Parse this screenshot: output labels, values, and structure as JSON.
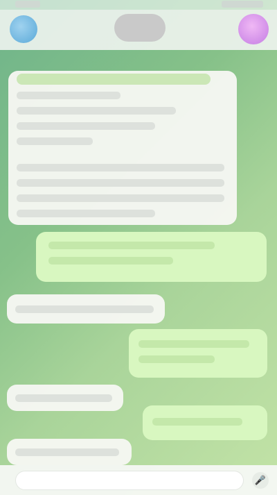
{
  "status_bar": {
    "time": "",
    "indicators": ""
  },
  "header": {
    "title": "",
    "subtitle": ""
  },
  "messages": [
    {
      "side": "incoming",
      "reply_to": "",
      "text": "",
      "time": ""
    },
    {
      "side": "outgoing",
      "text": "",
      "time": ""
    },
    {
      "side": "incoming",
      "text": "",
      "time": ""
    },
    {
      "side": "outgoing",
      "text": "",
      "time": ""
    },
    {
      "side": "incoming",
      "text": "",
      "time": ""
    },
    {
      "side": "outgoing",
      "text": "",
      "time": ""
    },
    {
      "side": "incoming",
      "text": "",
      "time": ""
    }
  ],
  "composer": {
    "placeholder": ""
  },
  "colors": {
    "wallpaper": "#86c189",
    "incoming_bubble": "#f6f7f2",
    "outgoing_bubble": "#d8f7c0"
  },
  "icons": {
    "back": "avatar-circle",
    "right": "contact-avatar",
    "mic": "mic-icon"
  }
}
